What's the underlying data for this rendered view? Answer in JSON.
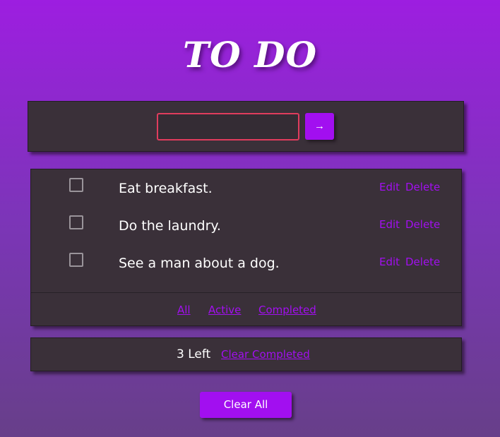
{
  "header": {
    "title": "TO DO"
  },
  "input": {
    "value": "",
    "placeholder": "",
    "submit_icon": "arrow-right-icon",
    "submit_glyph": "→"
  },
  "todos": [
    {
      "text": "Eat breakfast.",
      "completed": false,
      "edit_label": "Edit",
      "delete_label": "Delete"
    },
    {
      "text": "Do the laundry.",
      "completed": false,
      "edit_label": "Edit",
      "delete_label": "Delete"
    },
    {
      "text": "See a man about a dog.",
      "completed": false,
      "edit_label": "Edit",
      "delete_label": "Delete"
    }
  ],
  "filters": {
    "all": "All",
    "active": "Active",
    "completed": "Completed"
  },
  "status": {
    "left_text": "3 Left",
    "clear_completed_label": "Clear Completed"
  },
  "clear_all_label": "Clear All",
  "colors": {
    "accent": "#a20ff0",
    "panel": "#3a3039",
    "input_border": "#e03c5d"
  }
}
